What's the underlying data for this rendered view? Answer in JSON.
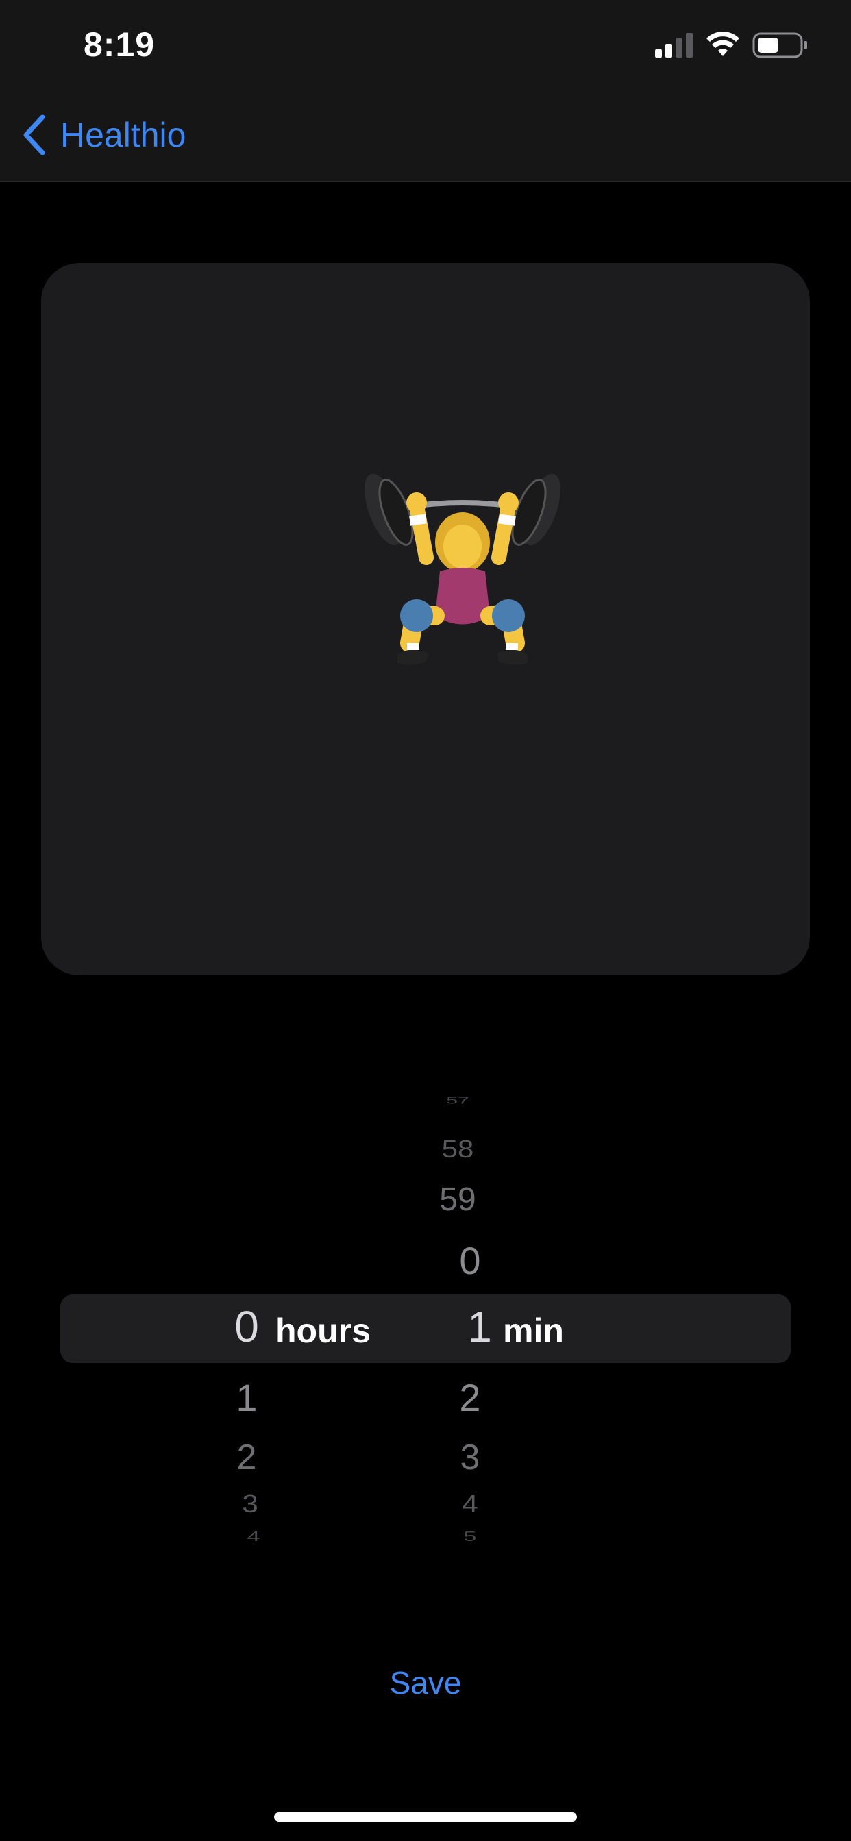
{
  "status_bar": {
    "time": "8:19"
  },
  "nav": {
    "back_label": "Healthio",
    "accent_color": "#3f87f5"
  },
  "card": {
    "icon": "weightlifter-icon"
  },
  "picker": {
    "hours": {
      "above": [],
      "selected": "0",
      "below": [
        "1",
        "2",
        "3",
        "4"
      ],
      "unit": "hours"
    },
    "minutes": {
      "above": [
        "57",
        "58",
        "59",
        "0"
      ],
      "selected": "1",
      "below": [
        "2",
        "3",
        "4",
        "5"
      ],
      "unit": "min"
    }
  },
  "save_label": "Save"
}
